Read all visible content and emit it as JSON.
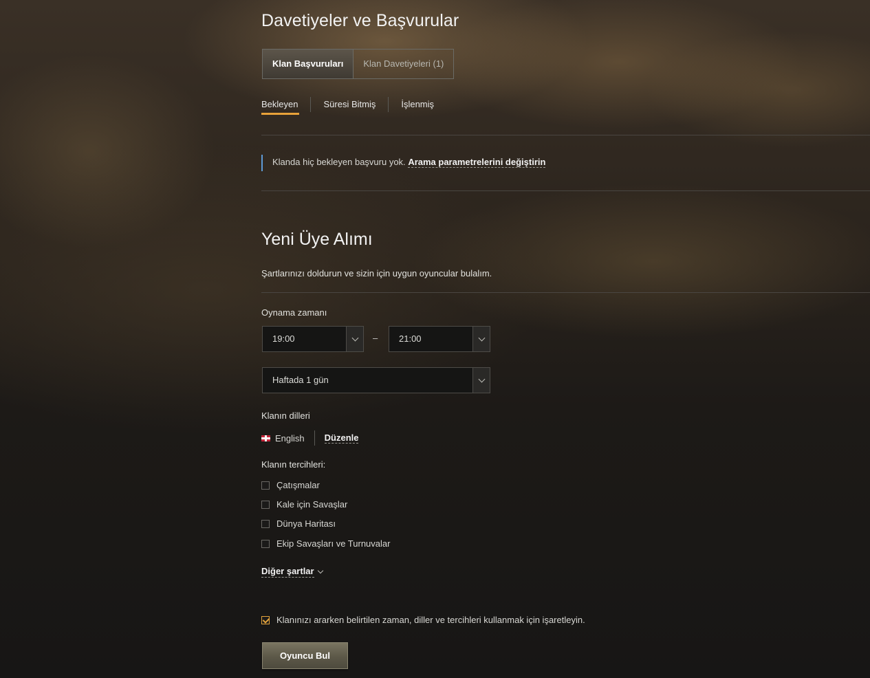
{
  "header": {
    "title": "Davetiyeler ve Başvurular"
  },
  "tabs": [
    {
      "label": "Klan Başvuruları",
      "active": true
    },
    {
      "label": "Klan Davetiyeleri (1)",
      "active": false
    }
  ],
  "subtabs": [
    {
      "label": "Bekleyen",
      "active": true
    },
    {
      "label": "Süresi Bitmiş",
      "active": false
    },
    {
      "label": "İşlenmiş",
      "active": false
    }
  ],
  "notice": {
    "text": "Klanda hiç bekleyen başvuru yok.",
    "link": "Arama parametrelerini değiştirin",
    "accent_color": "#5e9bd6"
  },
  "recruit": {
    "title": "Yeni Üye Alımı",
    "description": "Şartlarınızı doldurun ve sizin için uygun oyuncular bulalım.",
    "play_time": {
      "label": "Oynama zamanı",
      "from": "19:00",
      "separator": "–",
      "to": "21:00",
      "frequency": "Haftada 1 gün"
    },
    "languages": {
      "label": "Klanın dilleri",
      "items": [
        {
          "name": "English",
          "flag": "uk-flag-icon"
        }
      ],
      "edit": "Düzenle"
    },
    "preferences": {
      "label": "Klanın tercihleri:",
      "options": [
        {
          "label": "Çatışmalar",
          "checked": false
        },
        {
          "label": "Kale için Savaşlar",
          "checked": false
        },
        {
          "label": "Dünya Haritası",
          "checked": false
        },
        {
          "label": "Ekip Savaşları ve Turnuvalar",
          "checked": false
        }
      ]
    },
    "more_conditions": "Diğer şartlar",
    "use_params": {
      "label": "Klanınızı ararken belirtilen zaman, diller ve tercihleri kullanmak için işaretleyin.",
      "checked": true
    },
    "submit": "Oyuncu Bul"
  },
  "colors": {
    "accent": "#e8a23a",
    "link_accent": "#5e9bd6"
  }
}
